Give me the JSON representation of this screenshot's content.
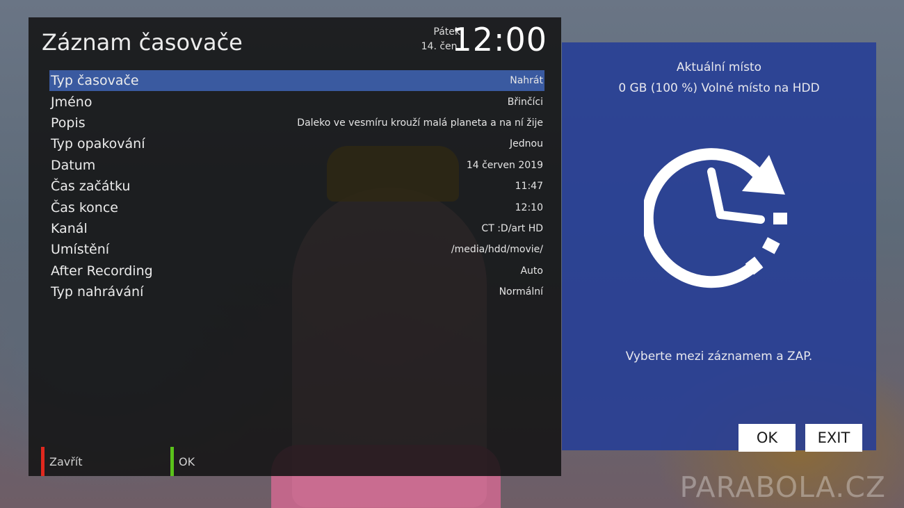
{
  "header": {
    "title": "Záznam časovače",
    "day": "Pátek",
    "date": "14. čen.",
    "time": "12:00"
  },
  "settings": [
    {
      "label": "Typ časovače",
      "value": "Nahrát",
      "selected": true
    },
    {
      "label": "Jméno",
      "value": "Břinčíci"
    },
    {
      "label": "Popis",
      "value": "Daleko ve vesmíru krouží malá planeta a na ní žije"
    },
    {
      "label": "Typ opakování",
      "value": "Jednou"
    },
    {
      "label": "Datum",
      "value": "14 červen 2019"
    },
    {
      "label": "Čas začátku",
      "value": "11:47"
    },
    {
      "label": "Čas konce",
      "value": "12:10"
    },
    {
      "label": "Kanál",
      "value": "CT :D/art HD"
    },
    {
      "label": "Umístění",
      "value": "/media/hdd/movie/"
    },
    {
      "label": "After Recording",
      "value": "Auto"
    },
    {
      "label": "Typ nahrávání",
      "value": "Normální"
    }
  ],
  "color_keys": {
    "red_label": "Zavřít",
    "green_label": "OK",
    "red_color": "#e0281e",
    "green_color": "#5ac21a"
  },
  "info": {
    "location_title": "Aktuální místo",
    "free_space": "0 GB (100 %) Volné místo na HDD",
    "icon": "timer-clock-icon",
    "hint": "Vyberte mezi záznamem a ZAP.",
    "ok_label": "OK",
    "exit_label": "EXIT"
  },
  "watermark": "PARABOLA.CZ",
  "colors": {
    "selection": "#3a5aa0",
    "info_panel": "#263e96"
  }
}
